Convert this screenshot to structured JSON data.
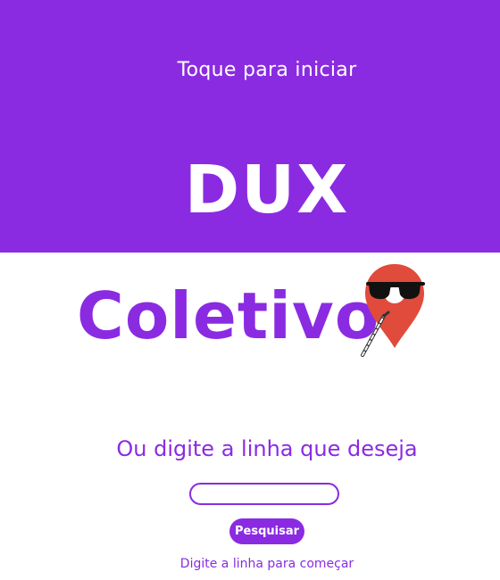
{
  "hero": {
    "tap_label": "Toque para iniciar",
    "brand_top": "DUX",
    "background_color": "#8a2be2"
  },
  "brand": {
    "bottom": "Coletivo",
    "logo_icon": "map-pin-sunglasses-cane-icon",
    "accent_color": "#8a2be2",
    "pin_color": "#e04b3c"
  },
  "search": {
    "prompt": "Ou digite a linha que deseja",
    "input_value": "",
    "button_label": "Pesquisar",
    "hint": "Digite a linha para começar"
  }
}
